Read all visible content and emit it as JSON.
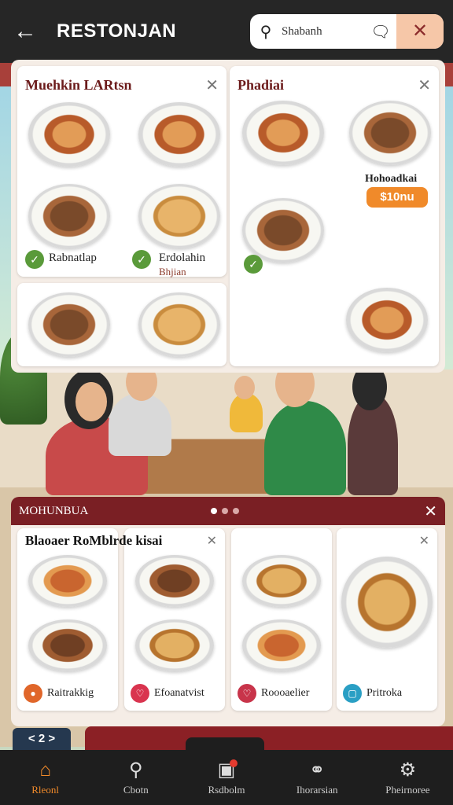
{
  "header": {
    "title": "RESTONJAN",
    "search_text": "Shabanh",
    "back_icon": "arrow-left-icon",
    "search_icon": "search-icon",
    "chat_icon": "chat-bubble-icon",
    "clear_icon": "clear-icon"
  },
  "top_panel": {
    "left_card": {
      "title": "Muehkin LARtsn",
      "items": [
        {
          "label": "Rabnatlap",
          "checked": true
        },
        {
          "label": "Erdolahin",
          "sub": "Bhjian",
          "checked": true
        }
      ]
    },
    "right_card": {
      "title": "Phadiai",
      "price_name": "Hohoadkai",
      "price": "$10nu",
      "checked": true
    }
  },
  "bottom_panel": {
    "title": "MOHUNBUA",
    "subtitle": "Blaoaer RoMblrde  kisai",
    "dots": [
      true,
      false,
      false
    ],
    "cards": [
      {
        "label": "Raitrakkig",
        "icon_color": "#e0662a"
      },
      {
        "label": "Efoanatvist",
        "icon_color": "#d9344f"
      },
      {
        "label": "Roooaelier",
        "icon_color": "#c8344a"
      },
      {
        "label": "Pritroka",
        "icon_color": "#2a9fc4"
      }
    ]
  },
  "pager": {
    "label": "< 2 >"
  },
  "nav": {
    "items": [
      {
        "label": "Rleonl",
        "icon": "home-icon",
        "active": true
      },
      {
        "label": "Cbotn",
        "icon": "search-icon",
        "active": false
      },
      {
        "label": "Rsdbolm",
        "icon": "chat-icon",
        "active": false
      },
      {
        "label": "Ihorarsian",
        "icon": "people-icon",
        "active": false
      },
      {
        "label": "Pheirnoree",
        "icon": "settings-icon",
        "active": false
      }
    ]
  },
  "colors": {
    "topbar": "#262626",
    "accent": "#f08a2a",
    "panel_header": "#7a1f24",
    "nav_bg": "#1e1e1e"
  }
}
